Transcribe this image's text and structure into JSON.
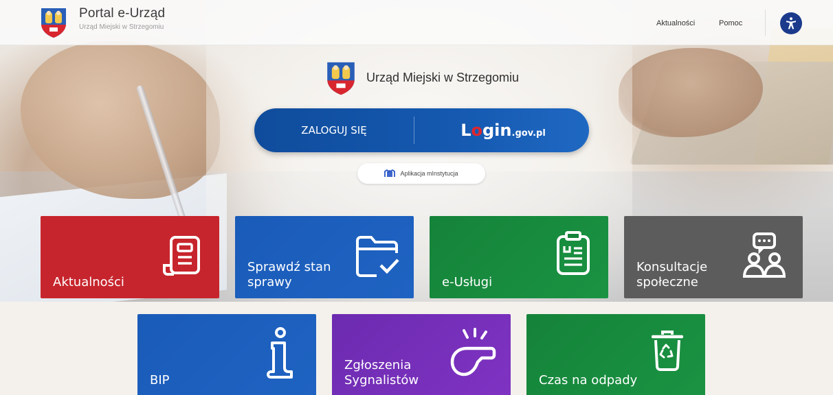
{
  "header": {
    "portal_title": "Portal e-Urząd",
    "portal_subtitle": "Urząd Miejski w Strzegomiu",
    "nav": {
      "news": "Aktualności",
      "help": "Pomoc"
    },
    "accessibility_icon": "accessibility-icon"
  },
  "hero": {
    "office_name": "Urząd Miejski w Strzegomiu",
    "login": {
      "label": "ZALOGUJ SIĘ",
      "gov_brand_l": "L",
      "gov_brand_o": "o",
      "gov_brand_rest": "gin",
      "gov_brand_suffix": ".gov.pl"
    },
    "app_button": "Aplikacja mInstytucja"
  },
  "tiles": [
    {
      "label": "Aktualności",
      "color": "#c7252d",
      "icon": "newspaper-icon"
    },
    {
      "label": "Sprawdź stan sprawy",
      "color": "#1a5bb8",
      "icon": "folder-check-icon"
    },
    {
      "label": "e-Usługi",
      "color": "#15833a",
      "icon": "document-list-icon"
    },
    {
      "label": "Konsultacje społeczne",
      "color": "#5c5c5c",
      "icon": "people-chat-icon"
    },
    {
      "label": "BIP",
      "color": "#1a5bb8",
      "icon": "info-icon"
    },
    {
      "label": "Zgłoszenia Sygnalistów",
      "color": "#6c2bb0",
      "icon": "whistle-icon"
    },
    {
      "label": "Czas na odpady",
      "color": "#15833a",
      "icon": "recycle-bin-icon"
    }
  ]
}
